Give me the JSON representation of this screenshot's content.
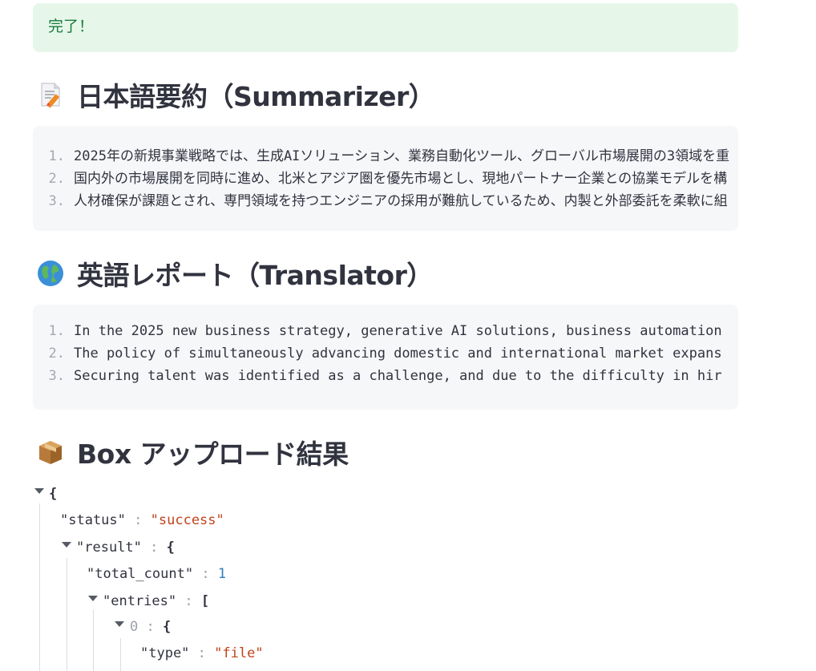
{
  "status": {
    "message": "完了！"
  },
  "sections": {
    "summarizer": {
      "title": "日本語要約（Summarizer）",
      "icon": "memo-pencil-icon",
      "lines": [
        {
          "num": "1.",
          "text": "2025年の新規事業戦略では、生成AIソリューション、業務自動化ツール、グローバル市場展開の3領域を重"
        },
        {
          "num": "2.",
          "text": "国内外の市場展開を同時に進め、北米とアジア圏を優先市場とし、現地パートナー企業との協業モデルを構"
        },
        {
          "num": "3.",
          "text": "人材確保が課題とされ、専門領域を持つエンジニアの採用が難航しているため、内製と外部委託を柔軟に組"
        }
      ]
    },
    "translator": {
      "title": "英語レポート（Translator）",
      "icon": "globe-icon",
      "lines": [
        {
          "num": "1.",
          "text": "In the 2025 new business strategy, generative AI solutions, business automation"
        },
        {
          "num": "2.",
          "text": "The policy of simultaneously advancing domestic and international market expans"
        },
        {
          "num": "3.",
          "text": "Securing talent was identified as a challenge, and due to the difficulty in hir"
        }
      ]
    },
    "box_upload": {
      "title": "Box アップロード結果",
      "icon": "package-icon"
    }
  },
  "json_view": {
    "open_brace": "{",
    "status_key": "\"status\"",
    "status_value": "\"success\"",
    "result_key": "\"result\"",
    "total_count_key": "\"total_count\"",
    "total_count_value": "1",
    "entries_key": "\"entries\"",
    "entries_bracket": "[",
    "index_0": "0",
    "type_key": "\"type\"",
    "type_value": "\"file\"",
    "colon": ":"
  }
}
